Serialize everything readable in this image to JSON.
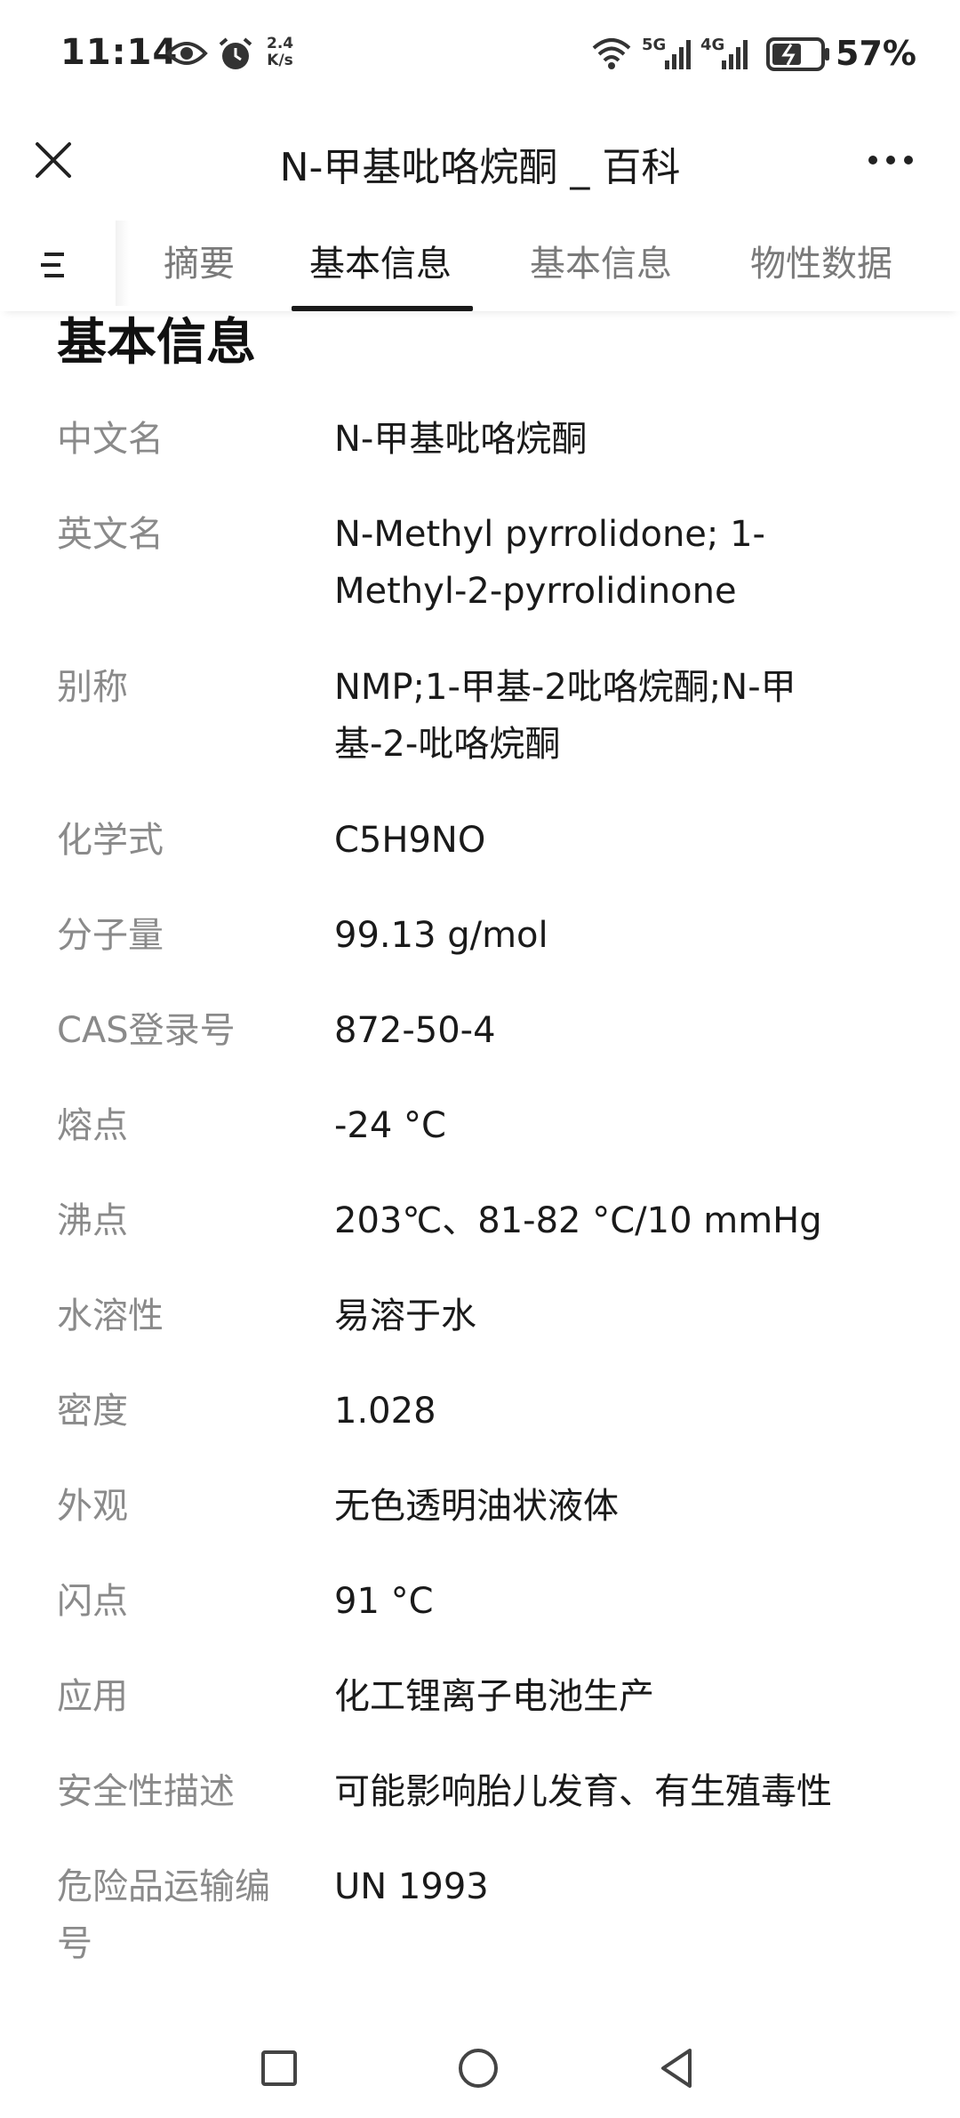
{
  "status_bar": {
    "time": "11:14",
    "speed_value": "2.4",
    "speed_unit": "K/s",
    "net1": "5G",
    "net2": "4G",
    "battery_pct": "57%",
    "icons": [
      "eye-icon",
      "alarm-icon",
      "wifi-icon",
      "signal-icon",
      "battery-icon"
    ]
  },
  "titlebar": {
    "title": "N-甲基吡咯烷酮 _ 百科",
    "icons": [
      "close-icon",
      "more-icon"
    ]
  },
  "tabs": [
    {
      "label": "摘要",
      "active": false
    },
    {
      "label": "基本信息",
      "active": true
    },
    {
      "label": "基本信息",
      "active": false
    },
    {
      "label": "物性数据",
      "active": false
    }
  ],
  "section": {
    "title": "基本信息"
  },
  "rows": [
    {
      "label": "中文名",
      "value": "N-甲基吡咯烷酮"
    },
    {
      "label": "英文名",
      "value_lines": [
        "N-Methyl pyrrolidone; 1-",
        "Methyl-2-pyrrolidinone"
      ]
    },
    {
      "label": "别称",
      "value_lines": [
        "NMP;1-甲基-2吡咯烷酮;N-甲",
        "基-2-吡咯烷酮"
      ]
    },
    {
      "label": "化学式",
      "value": "C5H9NO"
    },
    {
      "label": "分子量",
      "value": "99.13 g/mol"
    },
    {
      "label": "CAS登录号",
      "value": "872-50-4"
    },
    {
      "label": "熔点",
      "value": "-24 °C"
    },
    {
      "label": "沸点",
      "value": "203℃、81-82 °C/10 mmHg"
    },
    {
      "label": "水溶性",
      "value": "易溶于水"
    },
    {
      "label": "密度",
      "value": "1.028"
    },
    {
      "label": "外观",
      "value": "无色透明油状液体"
    },
    {
      "label": "闪点",
      "value": "91 °C"
    },
    {
      "label": "应用",
      "value": "化工锂离子电池生产"
    },
    {
      "label": "安全性描述",
      "value": "可能影响胎儿发育、有生殖毒性"
    },
    {
      "label_lines": [
        "危险品运输编",
        "号"
      ],
      "value": "UN 1993"
    }
  ],
  "navbar": {
    "icons": [
      "recent-apps-icon",
      "home-icon",
      "back-icon"
    ]
  }
}
